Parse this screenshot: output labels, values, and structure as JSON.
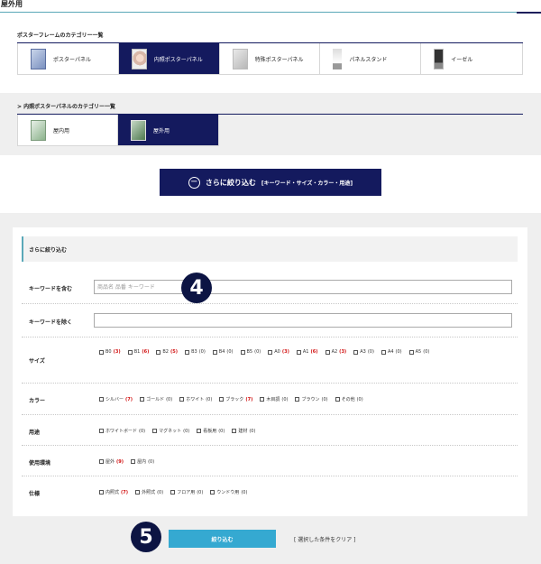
{
  "page": {
    "title": "屋外用"
  },
  "category_section": {
    "heading": "ポスターフレームのカテゴリー一覧",
    "items": [
      {
        "label": "ポスターパネル",
        "icon": "poster-panel-thumb",
        "active": false
      },
      {
        "label": "内照ポスターパネル",
        "icon": "lit-poster-panel-thumb",
        "active": true
      },
      {
        "label": "特殊ポスターパネル",
        "icon": "special-poster-panel-thumb",
        "active": false
      },
      {
        "label": "パネルスタンド",
        "icon": "panel-stand-thumb",
        "active": false
      },
      {
        "label": "イーゼル",
        "icon": "easel-thumb",
        "active": false
      }
    ]
  },
  "sub_category_section": {
    "heading": "> 内照ポスターパネルのカテゴリー一覧",
    "items": [
      {
        "label": "屋内用",
        "icon": "indoor-thumb",
        "active": false
      },
      {
        "label": "屋外用",
        "icon": "outdoor-thumb",
        "active": true
      }
    ]
  },
  "refine_button": {
    "symbol": "−",
    "main": "さらに絞り込む",
    "sub": "[キーワード・サイズ・カラー・用途]"
  },
  "filter": {
    "heading": "さらに絞り込む",
    "keyword_include": {
      "label": "キーワードを含む",
      "placeholder": "商品名 品番 キーワード"
    },
    "keyword_exclude": {
      "label": "キーワードを除く",
      "placeholder": ""
    },
    "size": {
      "label": "サイズ",
      "options": [
        {
          "name": "B0",
          "count": "(3)",
          "highlight": true
        },
        {
          "name": "B1",
          "count": "(6)",
          "highlight": true
        },
        {
          "name": "B2",
          "count": "(5)",
          "highlight": true
        },
        {
          "name": "B3",
          "count": "(0)",
          "highlight": false
        },
        {
          "name": "B4",
          "count": "(0)",
          "highlight": false
        },
        {
          "name": "B5",
          "count": "(0)",
          "highlight": false
        },
        {
          "name": "A0",
          "count": "(3)",
          "highlight": true
        },
        {
          "name": "A1",
          "count": "(6)",
          "highlight": true
        },
        {
          "name": "A2",
          "count": "(3)",
          "highlight": true
        },
        {
          "name": "A3",
          "count": "(0)",
          "highlight": false
        },
        {
          "name": "A4",
          "count": "(0)",
          "highlight": false
        },
        {
          "name": "A5",
          "count": "(0)",
          "highlight": false
        }
      ]
    },
    "color": {
      "label": "カラー",
      "options": [
        {
          "name": "シルバー",
          "count": "(7)",
          "highlight": true
        },
        {
          "name": "ゴールド",
          "count": "(0)",
          "highlight": false
        },
        {
          "name": "ホワイト",
          "count": "(0)",
          "highlight": false
        },
        {
          "name": "ブラック",
          "count": "(7)",
          "highlight": true
        },
        {
          "name": "木目調",
          "count": "(0)",
          "highlight": false
        },
        {
          "name": "ブラウン",
          "count": "(0)",
          "highlight": false
        },
        {
          "name": "その他",
          "count": "(0)",
          "highlight": false
        }
      ]
    },
    "usage": {
      "label": "用途",
      "options": [
        {
          "name": "ホワイトボード",
          "count": "(0)",
          "highlight": false
        },
        {
          "name": "マグネット",
          "count": "(0)",
          "highlight": false
        },
        {
          "name": "看板用",
          "count": "(0)",
          "highlight": false
        },
        {
          "name": "建材",
          "count": "(0)",
          "highlight": false
        }
      ]
    },
    "environment": {
      "label": "使用環境",
      "options": [
        {
          "name": "屋外",
          "count": "(9)",
          "highlight": true
        },
        {
          "name": "屋内",
          "count": "(0)",
          "highlight": false
        }
      ]
    },
    "spec": {
      "label": "仕様",
      "options": [
        {
          "name": "内照式",
          "count": "(7)",
          "highlight": true
        },
        {
          "name": "外照式",
          "count": "(0)",
          "highlight": false
        },
        {
          "name": "フロア用",
          "count": "(0)",
          "highlight": false
        },
        {
          "name": "ウンドウ用",
          "count": "(0)",
          "highlight": false
        }
      ]
    }
  },
  "actions": {
    "submit": "絞り込む",
    "clear": "[ 選択した条件をクリア ]"
  },
  "badges": {
    "step4": "4",
    "step5": "5"
  },
  "colors": {
    "navy": "#141a5e",
    "accent_teal": "#5aa8b8",
    "submit_blue": "#35a9d1",
    "count_red": "#d11010"
  }
}
